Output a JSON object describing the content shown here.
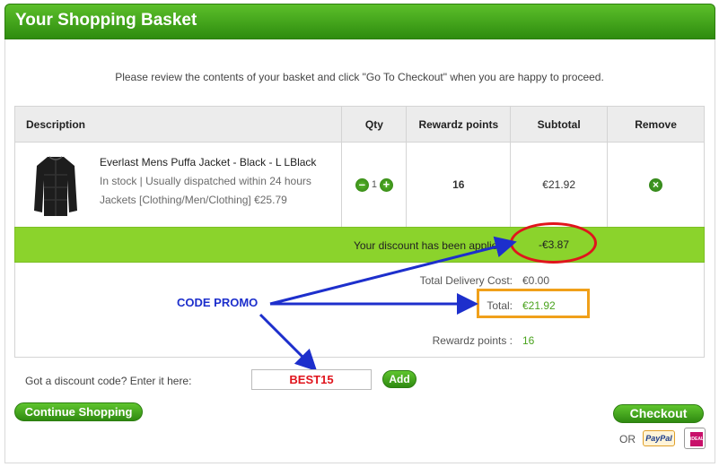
{
  "header": {
    "title": "Your Shopping Basket"
  },
  "intro": "Please review the contents of your basket and click \"Go To Checkout\" when you are happy to proceed.",
  "table": {
    "columns": [
      "Description",
      "Qty",
      "Rewardz points",
      "Subtotal",
      "Remove"
    ],
    "items": [
      {
        "name": "Everlast Mens Puffa Jacket - Black - L LBlack",
        "stock": "In stock | Usually dispatched within 24 hours",
        "category": "Jackets [Clothing/Men/Clothing] €25.79",
        "qty": "1",
        "points": "16",
        "subtotal": "€21.92"
      }
    ]
  },
  "discount": {
    "label": "Your discount has been applied:",
    "value": "-€3.87"
  },
  "summary": {
    "delivery_label": "Total Delivery Cost:",
    "delivery_value": "€0.00",
    "total_label": "Total:",
    "total_value": "€21.92",
    "points_label": "Rewardz points :",
    "points_value": "16"
  },
  "annotation": {
    "code_promo": "CODE PROMO"
  },
  "discount_code": {
    "prompt": "Got a discount code? Enter it here:",
    "value": "BEST15",
    "add_label": "Add"
  },
  "buttons": {
    "continue": "Continue Shopping",
    "checkout": "Checkout",
    "or": "OR"
  },
  "payment": {
    "paypal": "PayPal",
    "ideal": "iDEAL"
  },
  "icons": {
    "minus": "minus-icon",
    "plus": "plus-icon",
    "remove": "remove-icon"
  },
  "colors": {
    "brand_green": "#3a9a1a",
    "discount_bar": "#8bd32c",
    "annotation_blue": "#1d2fcc",
    "annotation_red": "#e0151c",
    "annotation_orange": "#f0a01a"
  }
}
